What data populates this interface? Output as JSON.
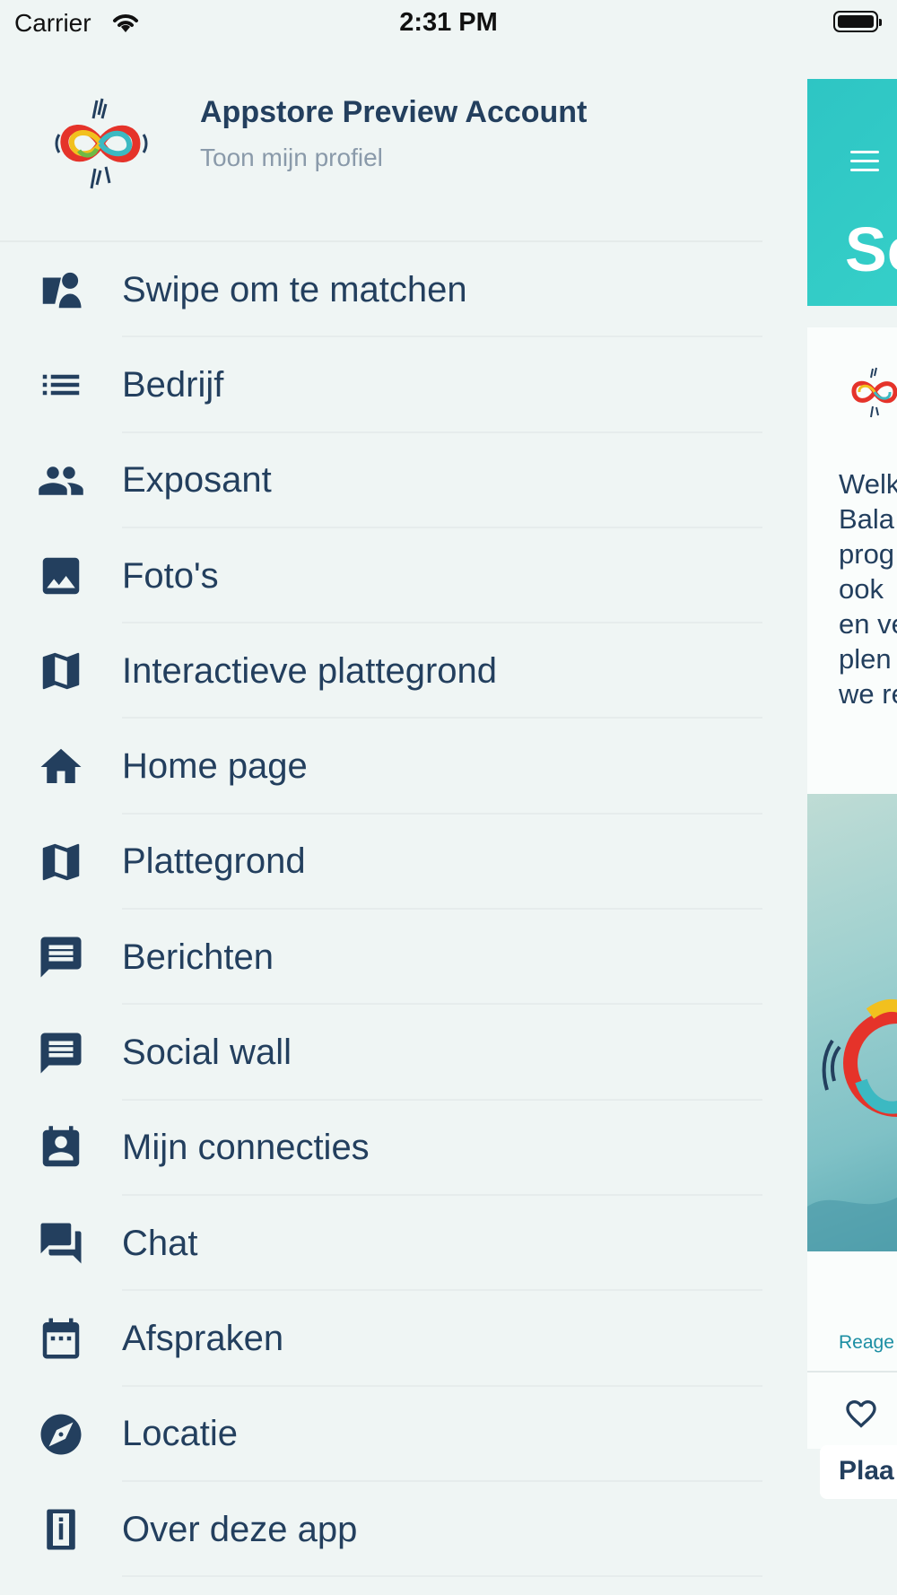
{
  "status_bar": {
    "carrier": "Carrier",
    "time": "2:31 PM"
  },
  "profile": {
    "account_name": "Appstore Preview Account",
    "profile_link": "Toon mijn profiel"
  },
  "menu": [
    {
      "label": "Swipe om te matchen",
      "icon": "swipe-match-icon"
    },
    {
      "label": "Bedrijf",
      "icon": "list-icon"
    },
    {
      "label": "Exposant",
      "icon": "people-icon"
    },
    {
      "label": "Foto's",
      "icon": "image-icon"
    },
    {
      "label": "Interactieve plattegrond",
      "icon": "map-icon"
    },
    {
      "label": "Home page",
      "icon": "home-icon"
    },
    {
      "label": "Plattegrond",
      "icon": "map-icon"
    },
    {
      "label": "Berichten",
      "icon": "message-icon"
    },
    {
      "label": "Social wall",
      "icon": "message-icon"
    },
    {
      "label": "Mijn connecties",
      "icon": "contact-card-icon"
    },
    {
      "label": "Chat",
      "icon": "chat-icon"
    },
    {
      "label": "Afspraken",
      "icon": "calendar-icon"
    },
    {
      "label": "Locatie",
      "icon": "compass-icon"
    },
    {
      "label": "Over deze app",
      "icon": "info-icon"
    }
  ],
  "peek": {
    "title": "Sc",
    "text_lines": [
      "Welk",
      "Bala",
      "prog",
      "ook",
      "en ve",
      "plen",
      "we re"
    ],
    "react_label": "Reage",
    "place_label": "Plaa"
  },
  "colors": {
    "text": "#233f5e",
    "muted": "#8a9aaa",
    "accent": "#2ec5c4",
    "background": "#eff5f4"
  }
}
